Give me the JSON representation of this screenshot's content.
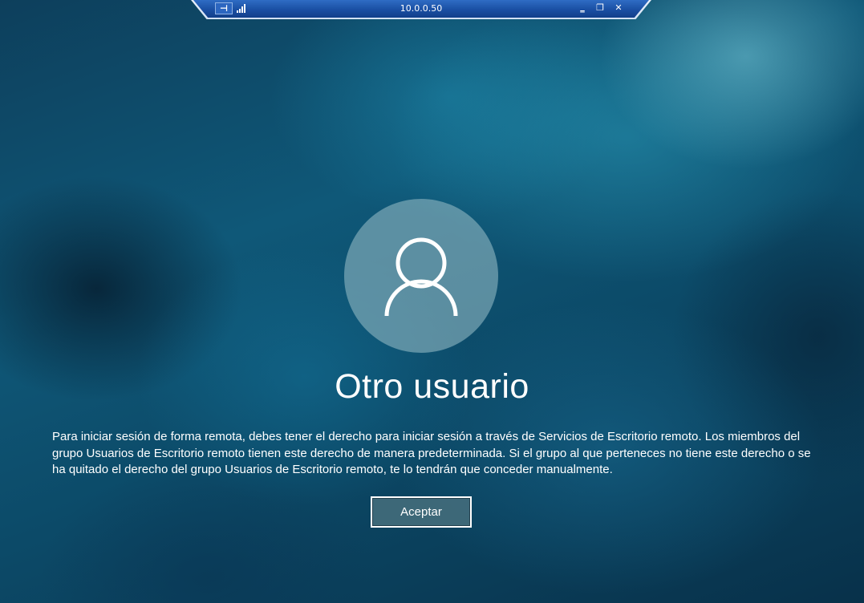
{
  "connection_bar": {
    "title": "10.0.0.50",
    "pin_glyph": "⊣",
    "minimize_glyph": "‗",
    "restore_glyph": "❐",
    "close_glyph": "✕",
    "icons": [
      "pin-icon",
      "signal-strength-icon",
      "minimize-icon",
      "restore-icon",
      "close-icon"
    ]
  },
  "login": {
    "user_name": "Otro usuario",
    "message": "Para iniciar sesión de forma remota, debes tener el derecho para iniciar sesión a través de Servicios de Escritorio remoto. Los miembros del grupo Usuarios de Escritorio remoto tienen este derecho de manera predeterminada. Si el grupo al que perteneces no tiene este derecho o se ha quitado el derecho del grupo Usuarios de Escritorio remoto, te lo tendrán que conceder manualmente.",
    "accept_button_label": "Aceptar"
  },
  "colors": {
    "background": "#0f5878",
    "connection_bar": "#1a4fa3",
    "avatar_circle": "#8cb4c0",
    "text": "#ffffff"
  }
}
